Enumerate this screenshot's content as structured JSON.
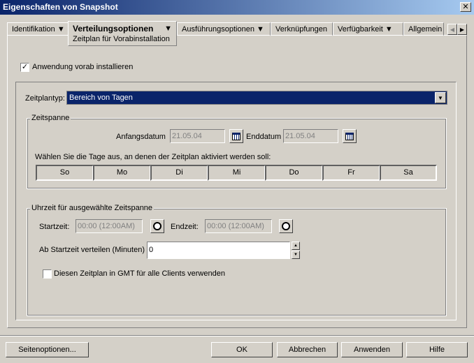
{
  "window": {
    "title": "Eigenschaften von Snapshot"
  },
  "tabs": [
    {
      "label": "Identifikation",
      "dropdown": true
    },
    {
      "label": "Verteilungsoptionen",
      "dropdown": true,
      "active": true,
      "subtab": "Zeitplan für Vorabinstallation"
    },
    {
      "label": "Ausführungsoptionen",
      "dropdown": true
    },
    {
      "label": "Verknüpfungen",
      "dropdown": false
    },
    {
      "label": "Verfügbarkeit",
      "dropdown": true
    },
    {
      "label": "Allgemein",
      "dropdown": false
    }
  ],
  "preinstall": {
    "label": "Anwendung vorab installieren",
    "checked": true
  },
  "schedule_type": {
    "label": "Zeitplantyp:",
    "value": "Bereich von Tagen"
  },
  "timespan": {
    "legend": "Zeitspanne",
    "start_label": "Anfangsdatum",
    "start_value": "21.05.04",
    "end_label": "Enddatum",
    "end_value": "21.05.04",
    "days_prompt": "Wählen Sie die Tage aus, an denen der Zeitplan aktiviert werden soll:",
    "days": [
      "So",
      "Mo",
      "Di",
      "Mi",
      "Do",
      "Fr",
      "Sa"
    ]
  },
  "time": {
    "legend": "Uhrzeit für ausgewählte Zeitspanne",
    "start_label": "Startzeit:",
    "start_value": "00:00 (12:00AM)",
    "end_label": "Endzeit:",
    "end_value": "00:00 (12:00AM)",
    "spread_label": "Ab Startzeit verteilen (Minuten)",
    "spread_value": "0",
    "gmt_label": "Diesen Zeitplan in GMT für alle Clients verwenden",
    "gmt_checked": false
  },
  "buttons": {
    "page_options": "Seitenoptionen...",
    "ok": "OK",
    "cancel": "Abbrechen",
    "apply": "Anwenden",
    "help": "Hilfe"
  },
  "colors": {
    "titlebar": "#0a246a",
    "selection": "#0a246a",
    "dialog": "#d4d0c8"
  }
}
